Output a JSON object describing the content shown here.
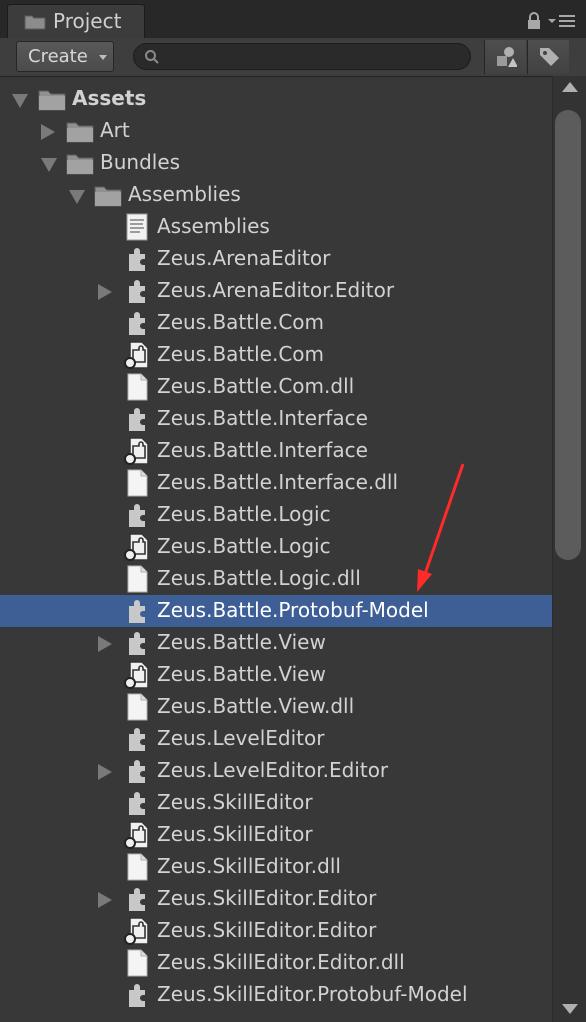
{
  "tab": {
    "title": "Project",
    "icon": "folder-icon"
  },
  "toolbar": {
    "create_label": "Create",
    "search_placeholder": "",
    "buttons": [
      "filter-by-type-icon",
      "filter-by-label-icon"
    ]
  },
  "tree": [
    {
      "label": "Assets",
      "icon": "folder",
      "arrow": "down",
      "depth": 0,
      "bold": true
    },
    {
      "label": "Art",
      "icon": "folder",
      "arrow": "right",
      "depth": 1
    },
    {
      "label": "Bundles",
      "icon": "folder",
      "arrow": "down",
      "depth": 1
    },
    {
      "label": "Assemblies",
      "icon": "folder",
      "arrow": "down",
      "depth": 2
    },
    {
      "label": "Assemblies",
      "icon": "text-asset",
      "arrow": "none",
      "depth": 3
    },
    {
      "label": "Zeus.ArenaEditor",
      "icon": "assembly",
      "arrow": "none",
      "depth": 3
    },
    {
      "label": "Zeus.ArenaEditor.Editor",
      "icon": "assembly",
      "arrow": "right",
      "depth": 3
    },
    {
      "label": "Zeus.Battle.Com",
      "icon": "assembly",
      "arrow": "none",
      "depth": 3
    },
    {
      "label": "Zeus.Battle.Com",
      "icon": "assembly-definition",
      "arrow": "none",
      "depth": 3
    },
    {
      "label": "Zeus.Battle.Com.dll",
      "icon": "file",
      "arrow": "none",
      "depth": 3
    },
    {
      "label": "Zeus.Battle.Interface",
      "icon": "assembly",
      "arrow": "none",
      "depth": 3
    },
    {
      "label": "Zeus.Battle.Interface",
      "icon": "assembly-definition",
      "arrow": "none",
      "depth": 3
    },
    {
      "label": "Zeus.Battle.Interface.dll",
      "icon": "file",
      "arrow": "none",
      "depth": 3
    },
    {
      "label": "Zeus.Battle.Logic",
      "icon": "assembly",
      "arrow": "none",
      "depth": 3
    },
    {
      "label": "Zeus.Battle.Logic",
      "icon": "assembly-definition",
      "arrow": "none",
      "depth": 3
    },
    {
      "label": "Zeus.Battle.Logic.dll",
      "icon": "file",
      "arrow": "none",
      "depth": 3
    },
    {
      "label": "Zeus.Battle.Protobuf-Model",
      "icon": "assembly",
      "arrow": "none",
      "depth": 3,
      "selected": true
    },
    {
      "label": "Zeus.Battle.View",
      "icon": "assembly",
      "arrow": "right",
      "depth": 3
    },
    {
      "label": "Zeus.Battle.View",
      "icon": "assembly-definition",
      "arrow": "none",
      "depth": 3
    },
    {
      "label": "Zeus.Battle.View.dll",
      "icon": "file",
      "arrow": "none",
      "depth": 3
    },
    {
      "label": "Zeus.LevelEditor",
      "icon": "assembly",
      "arrow": "none",
      "depth": 3
    },
    {
      "label": "Zeus.LevelEditor.Editor",
      "icon": "assembly",
      "arrow": "right",
      "depth": 3
    },
    {
      "label": "Zeus.SkillEditor",
      "icon": "assembly",
      "arrow": "none",
      "depth": 3
    },
    {
      "label": "Zeus.SkillEditor",
      "icon": "assembly-definition",
      "arrow": "none",
      "depth": 3
    },
    {
      "label": "Zeus.SkillEditor.dll",
      "icon": "file",
      "arrow": "none",
      "depth": 3
    },
    {
      "label": "Zeus.SkillEditor.Editor",
      "icon": "assembly",
      "arrow": "right",
      "depth": 3
    },
    {
      "label": "Zeus.SkillEditor.Editor",
      "icon": "assembly-definition",
      "arrow": "none",
      "depth": 3
    },
    {
      "label": "Zeus.SkillEditor.Editor.dll",
      "icon": "file",
      "arrow": "none",
      "depth": 3
    },
    {
      "label": "Zeus.SkillEditor.Protobuf-Model",
      "icon": "assembly",
      "arrow": "none",
      "depth": 3
    }
  ],
  "colors": {
    "selection": "#3e5f96",
    "background": "#383838",
    "annotation_arrow": "#ff2a2a"
  }
}
